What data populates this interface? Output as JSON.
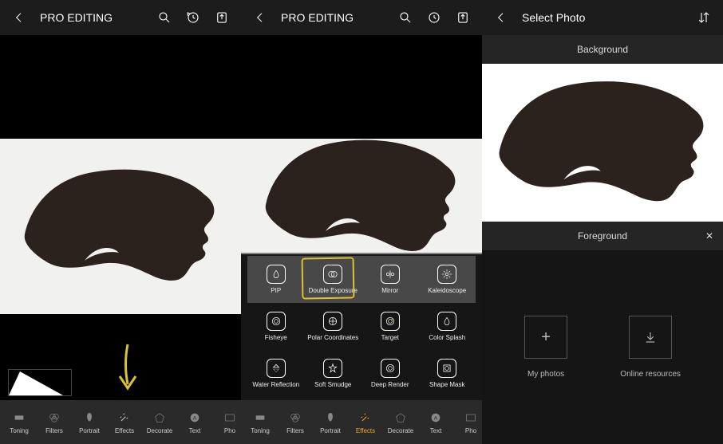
{
  "panel1": {
    "title": "PRO EDITING",
    "nav": [
      "Toning",
      "Filters",
      "Portrait",
      "Effects",
      "Decorate",
      "Text",
      "Pho"
    ],
    "active_index": 3
  },
  "panel2": {
    "title": "PRO EDITING",
    "nav": [
      "Toning",
      "Filters",
      "Portrait",
      "Effects",
      "Decorate",
      "Text",
      "Pho"
    ],
    "active_index": 3,
    "effects": [
      "PIP",
      "Double Exposure",
      "Mirror",
      "Kaleidoscope",
      "Fisheye",
      "Polar Coordinates",
      "Target",
      "Color Splash",
      "Water Reflection",
      "Soft Smudge",
      "Deep Render",
      "Shape Mask"
    ],
    "highlighted_effect_index": 1
  },
  "panel3": {
    "title": "Select Photo",
    "background_label": "Background",
    "foreground_label": "Foreground",
    "options": {
      "my_photos": "My photos",
      "online": "Online resources"
    }
  },
  "colors": {
    "accent": "#f5a623",
    "annotation": "#d9c233"
  }
}
